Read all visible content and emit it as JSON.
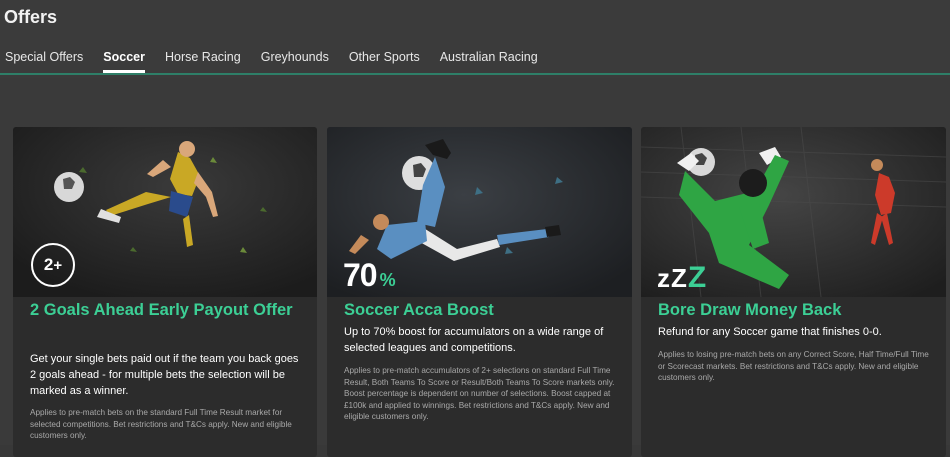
{
  "header": {
    "title": "Offers",
    "tabs": [
      {
        "label": "Special Offers",
        "active": false
      },
      {
        "label": "Soccer",
        "active": true
      },
      {
        "label": "Horse Racing",
        "active": false
      },
      {
        "label": "Greyhounds",
        "active": false
      },
      {
        "label": "Other Sports",
        "active": false
      },
      {
        "label": "Australian Racing",
        "active": false
      }
    ]
  },
  "colors": {
    "accent": "#3ccf95",
    "tab_rule": "#2e7f68",
    "background": "#383838",
    "card_background": "#2c2c2c"
  },
  "offers": [
    {
      "badge": "2+",
      "badge_main": "2",
      "badge_plus": "+",
      "title": "2 Goals Ahead Early Payout Offer",
      "description": "Get your single bets paid out if the team you back goes 2 goals ahead - for multiple bets the selection will be marked as a winner.",
      "terms": "Applies to pre-match bets on the standard Full Time Result market for selected competitions. Bet restrictions and T&Cs apply. New and eligible customers only.",
      "hero_icon": "soccer-player-kicking-ball-icon"
    },
    {
      "badge_main": "70",
      "badge_suffix": "%",
      "title": "Soccer Acca Boost",
      "description": "Up to 70% boost for accumulators on a wide range of selected leagues and competitions.",
      "terms": "Applies to pre-match accumulators of 2+ selections on standard Full Time Result, Both Teams To Score or Result/Both Teams To Score markets only. Boost percentage is dependent on number of selections. Boost capped at £100k and applied to winnings. Bet restrictions and T&Cs apply. New and eligible customers only.",
      "hero_icon": "overhead-kick-player-icon"
    },
    {
      "badge_small": "zZ",
      "badge_big": "Z",
      "title": "Bore Draw Money Back",
      "description": "Refund for any Soccer game that finishes 0-0.",
      "terms": "Applies to losing pre-match bets on any Correct Score, Half Time/Full Time or Scorecast markets. Bet restrictions and T&Cs apply. New and eligible customers only.",
      "hero_icon": "goalkeeper-diving-save-icon"
    }
  ]
}
